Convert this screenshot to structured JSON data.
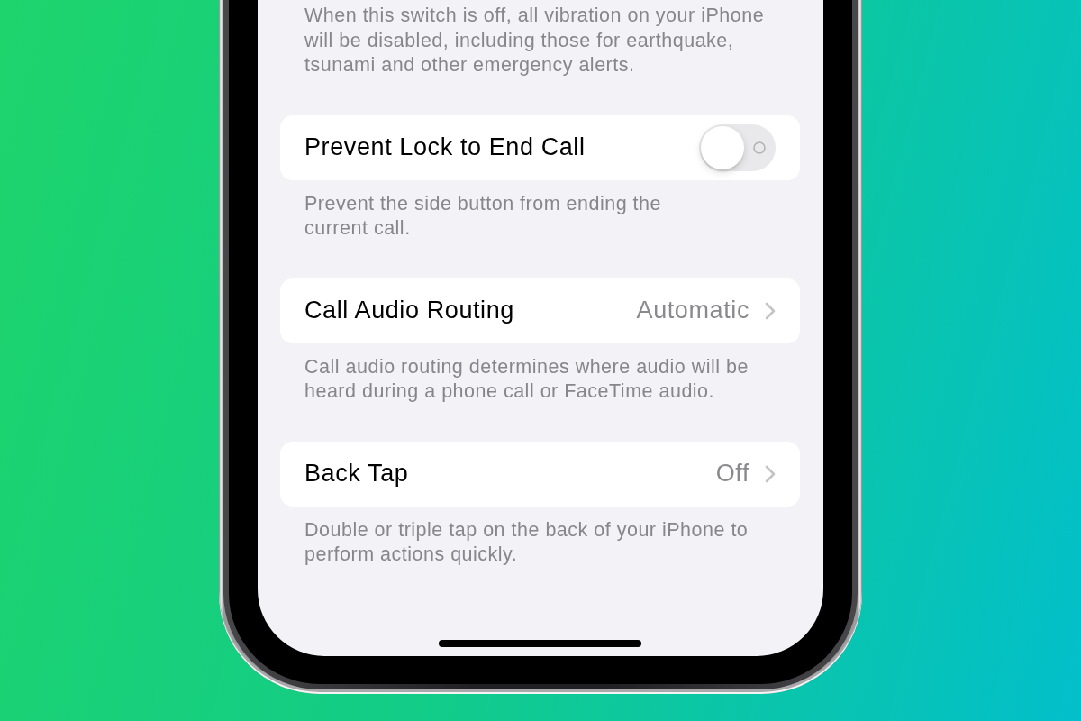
{
  "screen": {
    "sections": [
      {
        "footer": "When this switch is off, all vibration on your iPhone\nwill be disabled, including those for earthquake,\ntsunami and other emergency alerts."
      },
      {
        "row": {
          "kind": "toggle",
          "label": "Prevent Lock to End Call",
          "on": false
        },
        "footer": "Prevent the side button from ending the\ncurrent call."
      },
      {
        "row": {
          "kind": "link",
          "label": "Call Audio Routing",
          "value": "Automatic"
        },
        "footer": "Call audio routing determines where audio will be\nheard during a phone call or FaceTime audio."
      },
      {
        "row": {
          "kind": "link",
          "label": "Back Tap",
          "value": "Off"
        },
        "footer": "Double or triple tap on the back of your iPhone to\nperform actions quickly."
      }
    ]
  }
}
